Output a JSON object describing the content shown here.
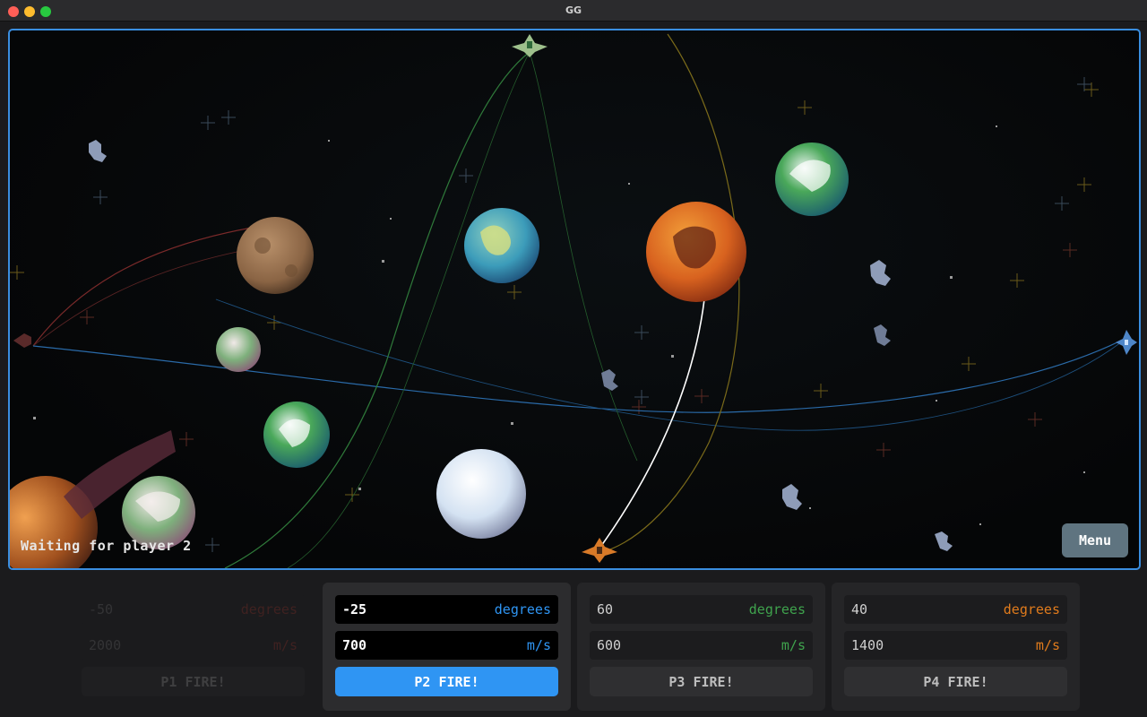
{
  "window": {
    "title": "GG"
  },
  "game": {
    "status": "Waiting for player 2",
    "menu_label": "Menu"
  },
  "players": [
    {
      "angle": "-50",
      "angle_unit": "degrees",
      "speed": "2000",
      "speed_unit": "m/s",
      "fire_label": "P1 FIRE!",
      "color": "#c0392b",
      "state": "disabled"
    },
    {
      "angle": "-25",
      "angle_unit": "degrees",
      "speed": "700",
      "speed_unit": "m/s",
      "fire_label": "P2 FIRE!",
      "color": "#2f95f3",
      "state": "active"
    },
    {
      "angle": "60",
      "angle_unit": "degrees",
      "speed": "600",
      "speed_unit": "m/s",
      "fire_label": "P3 FIRE!",
      "color": "#3fa34d",
      "state": "idle"
    },
    {
      "angle": "40",
      "angle_unit": "degrees",
      "speed": "1400",
      "speed_unit": "m/s",
      "fire_label": "P4 FIRE!",
      "color": "#e07b1c",
      "state": "idle"
    }
  ]
}
